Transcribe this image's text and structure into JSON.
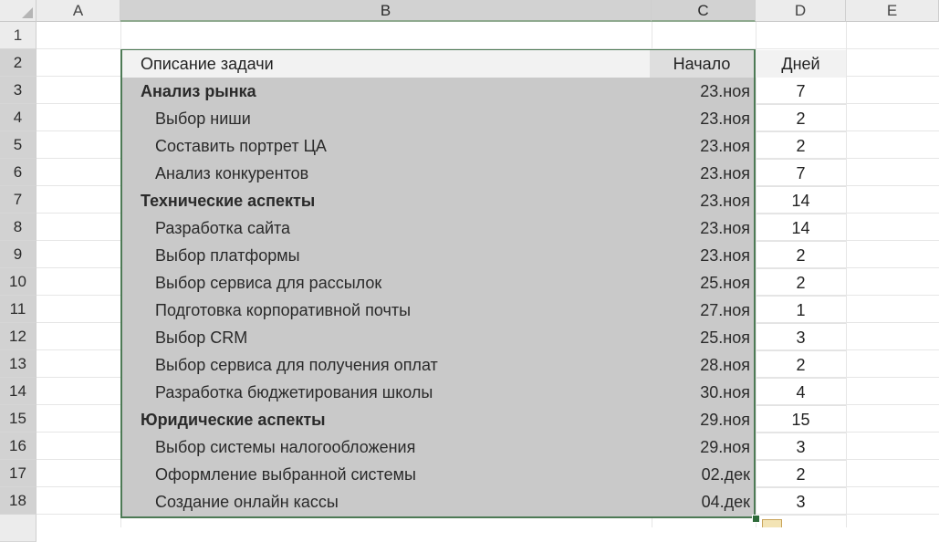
{
  "columns": [
    "A",
    "B",
    "C",
    "D",
    "E"
  ],
  "row_numbers": [
    "1",
    "2",
    "3",
    "4",
    "5",
    "6",
    "7",
    "8",
    "9",
    "10",
    "11",
    "12",
    "13",
    "14",
    "15",
    "16",
    "17",
    "18"
  ],
  "header": {
    "task": "Описание задачи",
    "start": "Начало",
    "days": "Дней"
  },
  "rows": [
    {
      "task": "Анализ рынка",
      "start": "23.ноя",
      "days": "7",
      "level": "group"
    },
    {
      "task": "Выбор ниши",
      "start": "23.ноя",
      "days": "2",
      "level": "sub"
    },
    {
      "task": "Составить портрет ЦА",
      "start": "23.ноя",
      "days": "2",
      "level": "sub"
    },
    {
      "task": "Анализ конкурентов",
      "start": "23.ноя",
      "days": "7",
      "level": "sub"
    },
    {
      "task": "Технические аспекты",
      "start": "23.ноя",
      "days": "14",
      "level": "group"
    },
    {
      "task": "Разработка сайта",
      "start": "23.ноя",
      "days": "14",
      "level": "sub"
    },
    {
      "task": "Выбор платформы",
      "start": "23.ноя",
      "days": "2",
      "level": "sub"
    },
    {
      "task": "Выбор сервиса для рассылок",
      "start": "25.ноя",
      "days": "2",
      "level": "sub"
    },
    {
      "task": "Подготовка корпоративной почты",
      "start": "27.ноя",
      "days": "1",
      "level": "sub"
    },
    {
      "task": "Выбор CRM",
      "start": "25.ноя",
      "days": "3",
      "level": "sub"
    },
    {
      "task": "Выбор сервиса для получения оплат",
      "start": "28.ноя",
      "days": "2",
      "level": "sub"
    },
    {
      "task": "Разработка бюджетирования школы",
      "start": "30.ноя",
      "days": "4",
      "level": "sub"
    },
    {
      "task": "Юридические аспекты",
      "start": "29.ноя",
      "days": "15",
      "level": "group"
    },
    {
      "task": "Выбор системы налогообложения",
      "start": "29.ноя",
      "days": "3",
      "level": "sub"
    },
    {
      "task": "Оформление выбранной системы",
      "start": "02.дек",
      "days": "2",
      "level": "sub"
    },
    {
      "task": "Создание онлайн кассы",
      "start": "04.дек",
      "days": "3",
      "level": "sub"
    }
  ],
  "colors": {
    "selection_fill": "#c9c9c9",
    "selection_border": "#4d7a55"
  }
}
